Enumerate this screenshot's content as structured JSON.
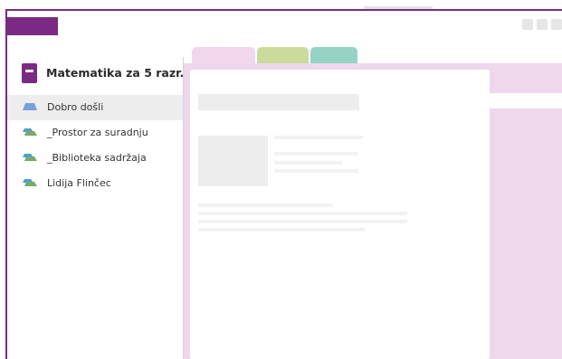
{
  "notebook": {
    "title": "Matematika za 5 razr...",
    "accent_color": "#7b2a83",
    "icon": "notebook-icon"
  },
  "sections": [
    {
      "label": "Dobro došli",
      "selected": true,
      "icon": "section-icon",
      "colors": [
        "#7aa0d8"
      ]
    },
    {
      "label": "_Prostor za suradnju",
      "selected": false,
      "icon": "section-group-icon",
      "colors": [
        "#4f9fd0",
        "#7aa86f"
      ]
    },
    {
      "label": "_Biblioteka sadržaja",
      "selected": false,
      "icon": "section-group-icon",
      "colors": [
        "#4f9fd0",
        "#7aa86f"
      ]
    },
    {
      "label": "Lidija Flinčec",
      "selected": false,
      "icon": "section-group-icon",
      "colors": [
        "#4f9fd0",
        "#7aa86f"
      ]
    }
  ],
  "tabs": [
    {
      "color": "#f1d6ec"
    },
    {
      "color": "#cadb9c"
    },
    {
      "color": "#97d3c5"
    }
  ],
  "page_background": "#efd7ec"
}
